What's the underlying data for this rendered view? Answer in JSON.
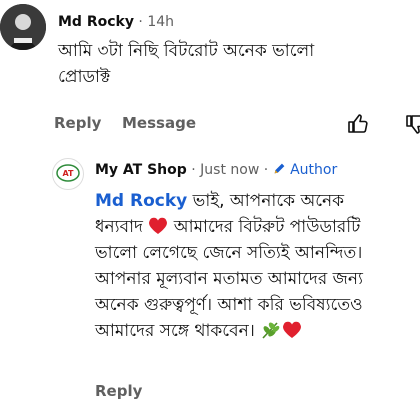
{
  "comment": {
    "author": "Md Rocky",
    "time": "14h",
    "text_line1": "আমি ৩টা নিছি বিটরোট অনেক ভালো",
    "text_line2": "প্রোডাক্ট",
    "reply_label": "Reply",
    "message_label": "Message"
  },
  "reply": {
    "author": "My AT Shop",
    "time": "Just now",
    "badge": "Author",
    "mention": "Md Rocky",
    "line1": " ভাই, আপনাকে অনেক",
    "line2a": "ধন্যবাদ ",
    "line2b": " আমাদের বিটরুট পাউডারটি",
    "line3": "ভালো লেগেছে জেনে সত্যিই আনন্দিত।",
    "line4": "আপনার মূল্যবান মতামত আমাদের জন্য",
    "line5": "অনেক গুরুত্বপূর্ণ। আশা করি ভবিষ্যতেও",
    "line6": "আমাদের সঙ্গে থাকবেন। ",
    "reply_label": "Reply"
  },
  "colors": {
    "accent": "#1a5fd0",
    "heart": "#e0202e",
    "leaf": "#5aa02c"
  }
}
